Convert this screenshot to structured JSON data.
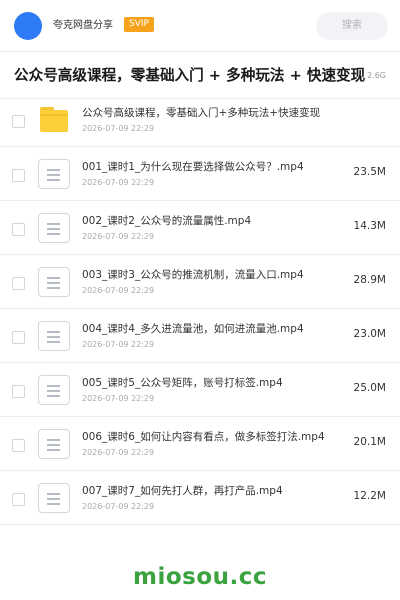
{
  "header": {
    "share_name": "夸克网盘分享",
    "badge": "SVIP",
    "search_placeholder": "搜索",
    "accent_color": "#2f7bf5",
    "badge_color": "#f6a31b"
  },
  "folder": {
    "title": "公众号高级课程，零基础入门 + 多种玩法 + 快速变现",
    "size": "2.6G"
  },
  "files": [
    {
      "type": "folder",
      "icon": "folder-icon",
      "name": "公众号高级课程，零基础入门+多种玩法+快速变现",
      "date": "2026-07-09 22:29",
      "size": ""
    },
    {
      "type": "file",
      "icon": "video-file-icon",
      "name": "001_课时1_为什么现在要选择做公众号？.mp4",
      "date": "2026-07-09 22:29",
      "size": "23.5M"
    },
    {
      "type": "file",
      "icon": "video-file-icon",
      "name": "002_课时2_公众号的流量属性.mp4",
      "date": "2026-07-09 22:29",
      "size": "14.3M"
    },
    {
      "type": "file",
      "icon": "video-file-icon",
      "name": "003_课时3_公众号的推流机制，流量入口.mp4",
      "date": "2026-07-09 22:29",
      "size": "28.9M"
    },
    {
      "type": "file",
      "icon": "video-file-icon",
      "name": "004_课时4_多久进流量池，如何进流量池.mp4",
      "date": "2026-07-09 22:29",
      "size": "23.0M"
    },
    {
      "type": "file",
      "icon": "video-file-icon",
      "name": "005_课时5_公众号矩阵，账号打标签.mp4",
      "date": "2026-07-09 22:29",
      "size": "25.0M"
    },
    {
      "type": "file",
      "icon": "video-file-icon",
      "name": "006_课时6_如何让内容有看点，做多标签打法.mp4",
      "date": "2026-07-09 22:29",
      "size": "20.1M"
    },
    {
      "type": "file",
      "icon": "video-file-icon",
      "name": "007_课时7_如何先打人群，再打产品.mp4",
      "date": "2026-07-09 22:29",
      "size": "12.2M"
    }
  ],
  "watermark": "miosou.cc"
}
